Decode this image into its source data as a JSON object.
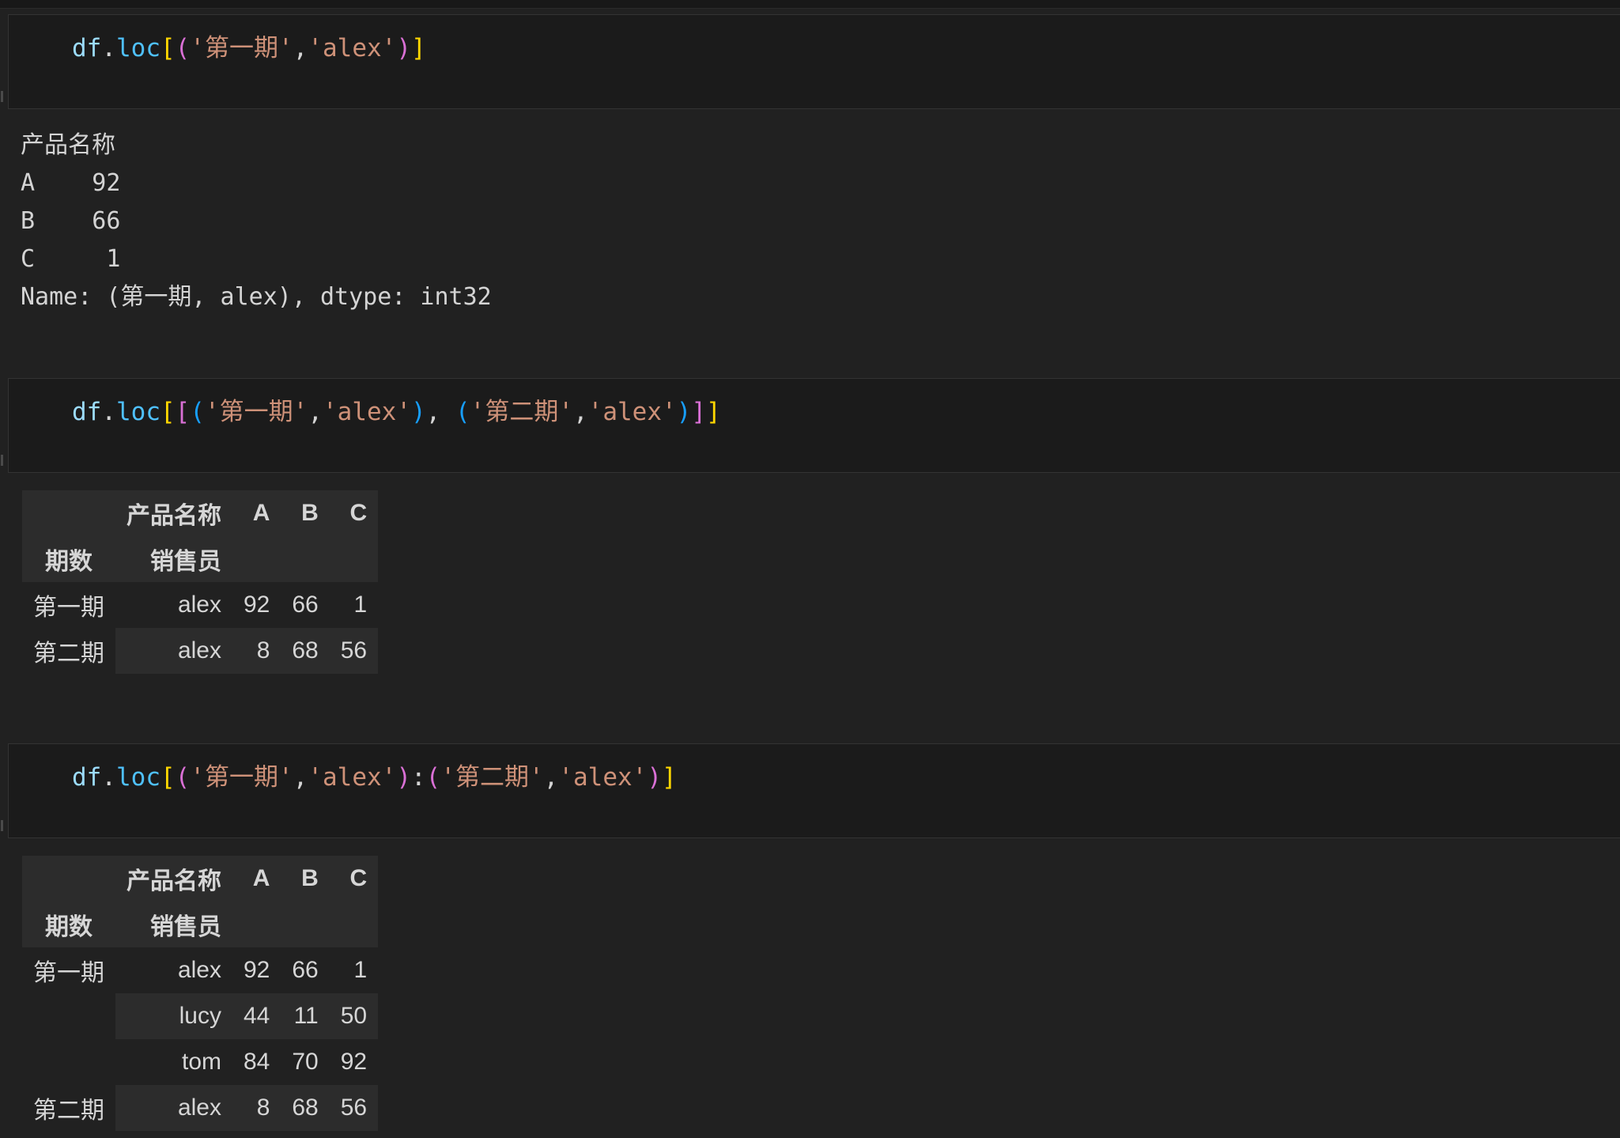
{
  "cells": [
    {
      "code_tokens": [
        {
          "t": "df",
          "c": "tok-var"
        },
        {
          "t": ".",
          "c": "tok-punc"
        },
        {
          "t": "loc",
          "c": "tok-fn"
        },
        {
          "t": "[",
          "c": "br1"
        },
        {
          "t": "(",
          "c": "br2"
        },
        {
          "t": "'第一期'",
          "c": "tok-str"
        },
        {
          "t": ",",
          "c": "tok-punc"
        },
        {
          "t": "'alex'",
          "c": "tok-str"
        },
        {
          "t": ")",
          "c": "br2"
        },
        {
          "t": "]",
          "c": "br1"
        }
      ],
      "output_text": "产品名称\nA    92\nB    66\nC     1\nName: (第一期, alex), dtype: int32"
    },
    {
      "code_tokens": [
        {
          "t": "df",
          "c": "tok-var"
        },
        {
          "t": ".",
          "c": "tok-punc"
        },
        {
          "t": "loc",
          "c": "tok-fn"
        },
        {
          "t": "[",
          "c": "br1"
        },
        {
          "t": "[",
          "c": "br2"
        },
        {
          "t": "(",
          "c": "br3"
        },
        {
          "t": "'第一期'",
          "c": "tok-str"
        },
        {
          "t": ",",
          "c": "tok-punc"
        },
        {
          "t": "'alex'",
          "c": "tok-str"
        },
        {
          "t": ")",
          "c": "br3"
        },
        {
          "t": ", ",
          "c": "tok-punc"
        },
        {
          "t": "(",
          "c": "br3"
        },
        {
          "t": "'第二期'",
          "c": "tok-str"
        },
        {
          "t": ",",
          "c": "tok-punc"
        },
        {
          "t": "'alex'",
          "c": "tok-str"
        },
        {
          "t": ")",
          "c": "br3"
        },
        {
          "t": "]",
          "c": "br2"
        },
        {
          "t": "]",
          "c": "br1"
        }
      ],
      "table": {
        "columns_name": "产品名称",
        "columns": [
          "A",
          "B",
          "C"
        ],
        "index_names": [
          "期数",
          "销售员"
        ],
        "rows": [
          {
            "lvl1": "第一期",
            "lvl2": "alex",
            "values": [
              "92",
              "66",
              "1"
            ]
          },
          {
            "lvl1": "第二期",
            "lvl2": "alex",
            "values": [
              "8",
              "68",
              "56"
            ]
          }
        ]
      }
    },
    {
      "code_tokens": [
        {
          "t": "df",
          "c": "tok-var"
        },
        {
          "t": ".",
          "c": "tok-punc"
        },
        {
          "t": "loc",
          "c": "tok-fn"
        },
        {
          "t": "[",
          "c": "br1"
        },
        {
          "t": "(",
          "c": "br2"
        },
        {
          "t": "'第一期'",
          "c": "tok-str"
        },
        {
          "t": ",",
          "c": "tok-punc"
        },
        {
          "t": "'alex'",
          "c": "tok-str"
        },
        {
          "t": ")",
          "c": "br2"
        },
        {
          "t": ":",
          "c": "tok-punc"
        },
        {
          "t": "(",
          "c": "br2"
        },
        {
          "t": "'第二期'",
          "c": "tok-str"
        },
        {
          "t": ",",
          "c": "tok-punc"
        },
        {
          "t": "'alex'",
          "c": "tok-str"
        },
        {
          "t": ")",
          "c": "br2"
        },
        {
          "t": "]",
          "c": "br1"
        }
      ],
      "table": {
        "columns_name": "产品名称",
        "columns": [
          "A",
          "B",
          "C"
        ],
        "index_names": [
          "期数",
          "销售员"
        ],
        "rows": [
          {
            "lvl1": "第一期",
            "lvl2": "alex",
            "values": [
              "92",
              "66",
              "1"
            ]
          },
          {
            "lvl1": "",
            "lvl2": "lucy",
            "values": [
              "44",
              "11",
              "50"
            ]
          },
          {
            "lvl1": "",
            "lvl2": "tom",
            "values": [
              "84",
              "70",
              "92"
            ]
          },
          {
            "lvl1": "第二期",
            "lvl2": "alex",
            "values": [
              "8",
              "68",
              "56"
            ]
          }
        ]
      }
    }
  ]
}
